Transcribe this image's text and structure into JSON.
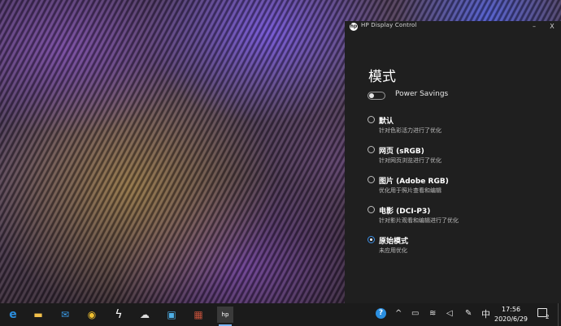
{
  "app": {
    "title": "HP Display Control",
    "logo_text": "hp",
    "min_glyph": "–",
    "close_glyph": "X"
  },
  "main": {
    "heading": "模式",
    "toggle": {
      "label": "Power Savings",
      "on": false
    },
    "options": [
      {
        "title": "默认",
        "subtitle": "针对色彩活力进行了优化",
        "selected": false
      },
      {
        "title": "网页 (sRGB)",
        "subtitle": "针对网页浏览进行了优化",
        "selected": false
      },
      {
        "title": "图片 (Adobe RGB)",
        "subtitle": "优化用于照片查看和编辑",
        "selected": false
      },
      {
        "title": "电影 (DCI-P3)",
        "subtitle": "针对影片观看和编辑进行了优化",
        "selected": false
      },
      {
        "title": "原始模式",
        "subtitle": "未应用优化",
        "selected": true
      }
    ]
  },
  "taskbar": {
    "apps": [
      {
        "name": "edge-icon",
        "glyph": "e",
        "color": "#2b8fe0"
      },
      {
        "name": "file-explorer-icon",
        "glyph": "▬",
        "color": "#f2c04a"
      },
      {
        "name": "mail-icon",
        "glyph": "✉",
        "color": "#3a9be8"
      },
      {
        "name": "chrome-icon",
        "glyph": "◉",
        "color": "#f0c030"
      },
      {
        "name": "lightning-app-icon",
        "glyph": "ϟ",
        "color": "#ffffff"
      },
      {
        "name": "network-globe-app-icon",
        "glyph": "☁",
        "color": "#dcdcdc"
      },
      {
        "name": "photo-app-icon",
        "glyph": "▣",
        "color": "#4fb0e8"
      },
      {
        "name": "winrar-icon",
        "glyph": "▦",
        "color": "#c0503a"
      },
      {
        "name": "hp-display-control-icon",
        "glyph": "hp",
        "color": "#ffffff"
      }
    ],
    "tray": {
      "help_glyph": "?",
      "chevron_glyph": "^",
      "battery_glyph": "▭",
      "wifi_glyph": "≋",
      "volume_glyph": "◁",
      "pen_glyph": "✎",
      "ime_label": "中",
      "time": "17:56",
      "date": "2020/6/29",
      "notification_count": "2"
    }
  }
}
